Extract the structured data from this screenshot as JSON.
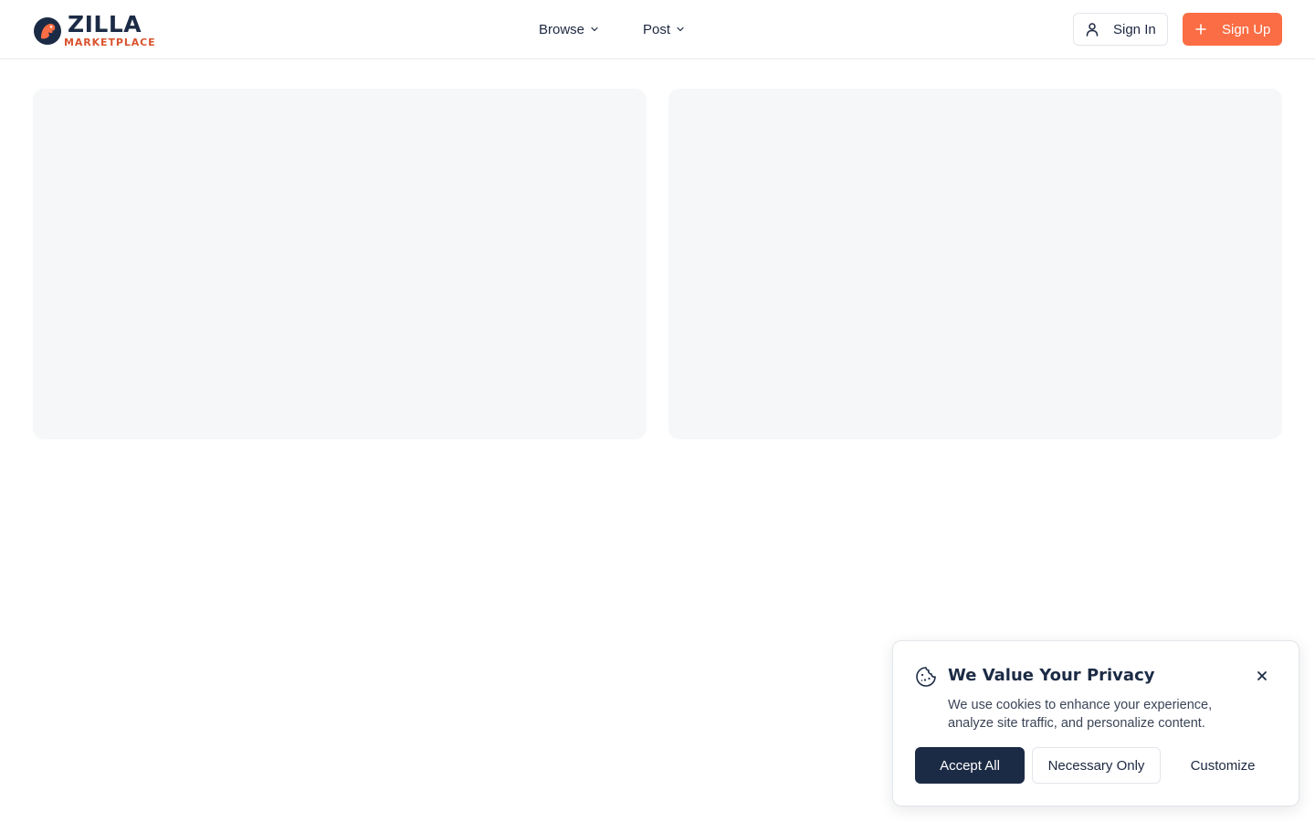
{
  "header": {
    "logo": {
      "title": "ZILLA",
      "subtitle": "MARKETPLACE",
      "icon": "zilla-logo-icon"
    },
    "nav": [
      {
        "label": "Browse",
        "icon": "chevron-down-icon"
      },
      {
        "label": "Post",
        "icon": "chevron-down-icon"
      }
    ],
    "sign_in": {
      "label": "Sign In",
      "icon": "user-icon"
    },
    "sign_up": {
      "label": "Sign Up",
      "icon": "plus-icon"
    }
  },
  "cookie_banner": {
    "icon": "cookie-icon",
    "title": "We Value Your Privacy",
    "text": "We use cookies to enhance your experience, analyze site traffic, and personalize content.",
    "accept_label": "Accept All",
    "necessary_label": "Necessary Only",
    "customize_label": "Customize",
    "close_icon": "close-icon"
  },
  "colors": {
    "brand_navy": "#1c2b45",
    "brand_orange": "#fb6d44",
    "skeleton": "#f6f7f9"
  }
}
